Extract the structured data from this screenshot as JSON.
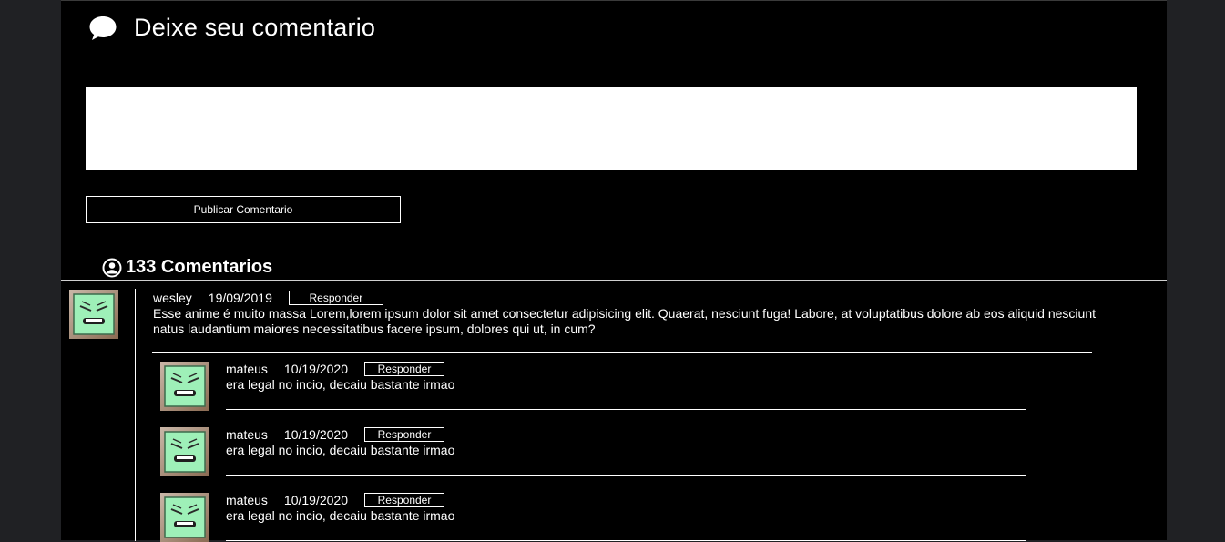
{
  "header": {
    "title": "Deixe seu comentario"
  },
  "composer": {
    "placeholder": "",
    "value": "",
    "publish_label": "Publicar Comentario"
  },
  "comments_count": "133 Comentarios",
  "main_comment": {
    "author": "wesley",
    "date": "19/09/2019",
    "reply_label": "Responder",
    "text": "Esse anime é muito massa Lorem,lorem ipsum dolor sit amet consectetur adipisicing elit. Quaerat, nesciunt fuga! Labore, at voluptatibus dolore ab eos aliquid nesciunt natus laudantium maiores necessitatibus facere ipsum, dolores qui ut, in cum?"
  },
  "replies": [
    {
      "author": "mateus",
      "date": "10/19/2020",
      "reply_label": "Responder",
      "text": "era legal no incio, decaiu bastante irmao"
    },
    {
      "author": "mateus",
      "date": "10/19/2020",
      "reply_label": "Responder",
      "text": "era legal no incio, decaiu bastante irmao"
    },
    {
      "author": "mateus",
      "date": "10/19/2020",
      "reply_label": "Responder",
      "text": "era legal no incio, decaiu bastante irmao"
    }
  ],
  "colors": {
    "background": "#202124",
    "panel": "#000000",
    "text": "#ffffff",
    "avatar_face": "#9ef0b8"
  },
  "icons": {
    "header": "speech-bubble-icon",
    "count": "user-circle-icon",
    "avatar": "smiley-box-icon"
  }
}
